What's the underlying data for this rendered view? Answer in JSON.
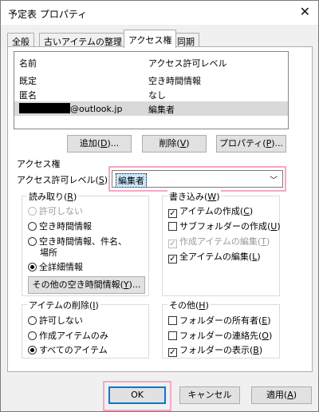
{
  "window": {
    "title": "予定表 プロパティ",
    "close_glyph": "✕"
  },
  "tabs": [
    {
      "label": "全般"
    },
    {
      "label": "古いアイテムの整理"
    },
    {
      "label": "アクセス権"
    },
    {
      "label": "同期"
    }
  ],
  "permissions": {
    "columns": {
      "name": "名前",
      "level": "アクセス許可レベル"
    },
    "rows": [
      {
        "name": "既定",
        "level": "空き時間情報"
      },
      {
        "name": "匿名",
        "level": "なし"
      },
      {
        "name_suffix": "@outlook.jp",
        "level": "編集者"
      }
    ]
  },
  "buttons": {
    "add": {
      "text": "追加(",
      "key": "D",
      "tail": ")..."
    },
    "delete": {
      "text": "削除(",
      "key": "V",
      "tail": ")"
    },
    "properties": {
      "text": "プロパティ(",
      "key": "P",
      "tail": ")..."
    },
    "other_freebusy": {
      "text": "その他の空き時間情報(",
      "key": "Y",
      "tail": ")..."
    },
    "ok": {
      "text": "OK"
    },
    "cancel": {
      "text": "キャンセル"
    },
    "apply": {
      "text": "適用(",
      "key": "A",
      "tail": ")"
    }
  },
  "access": {
    "section_label": "アクセス権",
    "level_label": {
      "text": "アクセス許可レベル(",
      "key": "S",
      "tail": "):"
    },
    "level_value": "編集者",
    "dropdown_glyph": "﹀"
  },
  "read": {
    "title": {
      "text": "読み取り(",
      "key": "R",
      "tail": ")"
    },
    "options": [
      {
        "label": "許可しない"
      },
      {
        "label": "空き時間情報"
      },
      {
        "label": "空き時間情報、件名、"
      },
      {
        "label": "場所"
      },
      {
        "label": "全詳細情報"
      }
    ]
  },
  "write": {
    "title": {
      "text": "書き込み(",
      "key": "W",
      "tail": ")"
    },
    "options": [
      {
        "text": "アイテムの作成(",
        "key": "C",
        "tail": ")"
      },
      {
        "text": "サブフォルダーの作成(",
        "key": "U",
        "tail": ")"
      },
      {
        "text": "作成アイテムの編集(",
        "key": "T",
        "tail": ")"
      },
      {
        "text": "全アイテムの編集(",
        "key": "L",
        "tail": ")"
      }
    ]
  },
  "delete_items": {
    "title": {
      "text": "アイテムの削除(",
      "key": "I",
      "tail": ")"
    },
    "options": [
      {
        "label": "許可しない"
      },
      {
        "label": "作成アイテムのみ"
      },
      {
        "label": "すべてのアイテム"
      }
    ]
  },
  "other": {
    "title": {
      "text": "その他(",
      "key": "H",
      "tail": ")"
    },
    "options": [
      {
        "text": "フォルダーの所有者(",
        "key": "E",
        "tail": ")"
      },
      {
        "text": "フォルダーの連絡先(",
        "key": "O",
        "tail": ")"
      },
      {
        "text": "フォルダーの表示(",
        "key": "B",
        "tail": ")"
      }
    ]
  },
  "checkmark": "✓",
  "colors": {
    "highlight": "#f4a8c8",
    "selection": "#cde8ff",
    "default_button_border": "#0078d7"
  }
}
